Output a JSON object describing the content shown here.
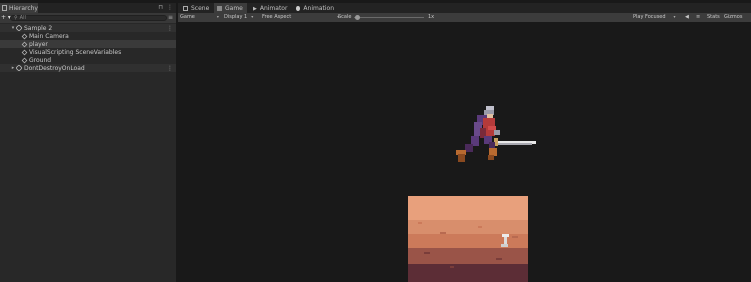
{
  "hierarchy": {
    "tab_label": "Hierarchy",
    "add_label": "+ ▾",
    "search_placeholder": "All",
    "items": [
      {
        "label": "Sample 2",
        "type": "scene",
        "expanded": true
      },
      {
        "label": "Main Camera",
        "type": "gameobject"
      },
      {
        "label": "player",
        "type": "gameobject",
        "selected": true
      },
      {
        "label": "VisualScripting SceneVariables",
        "type": "gameobject"
      },
      {
        "label": "Ground",
        "type": "gameobject"
      },
      {
        "label": "DontDestroyOnLoad",
        "type": "scene",
        "expanded": false
      }
    ]
  },
  "tabs": [
    {
      "label": "Scene",
      "icon": "scene-icon"
    },
    {
      "label": "Game",
      "icon": "game-icon",
      "active": true
    },
    {
      "label": "Animator",
      "icon": "animator-icon"
    },
    {
      "label": "Animation",
      "icon": "animation-icon"
    }
  ],
  "game_toolbar": {
    "mode": "Game",
    "display": "Display 1",
    "aspect": "Free Aspect",
    "scale_label": "Scale",
    "scale_value": "1x",
    "play_mode": "Play Focused",
    "stats": "Stats",
    "gizmos": "Gizmos"
  },
  "colors": {
    "accent_selected": "#3a3a3a",
    "panel_bg": "#282828",
    "viewport_bg": "#191919",
    "ground_top": "#e8a07c",
    "ground_mid": "#cc7a5a",
    "ground_dark": "#7a3d3a",
    "ground_bottom": "#5c2d36"
  }
}
